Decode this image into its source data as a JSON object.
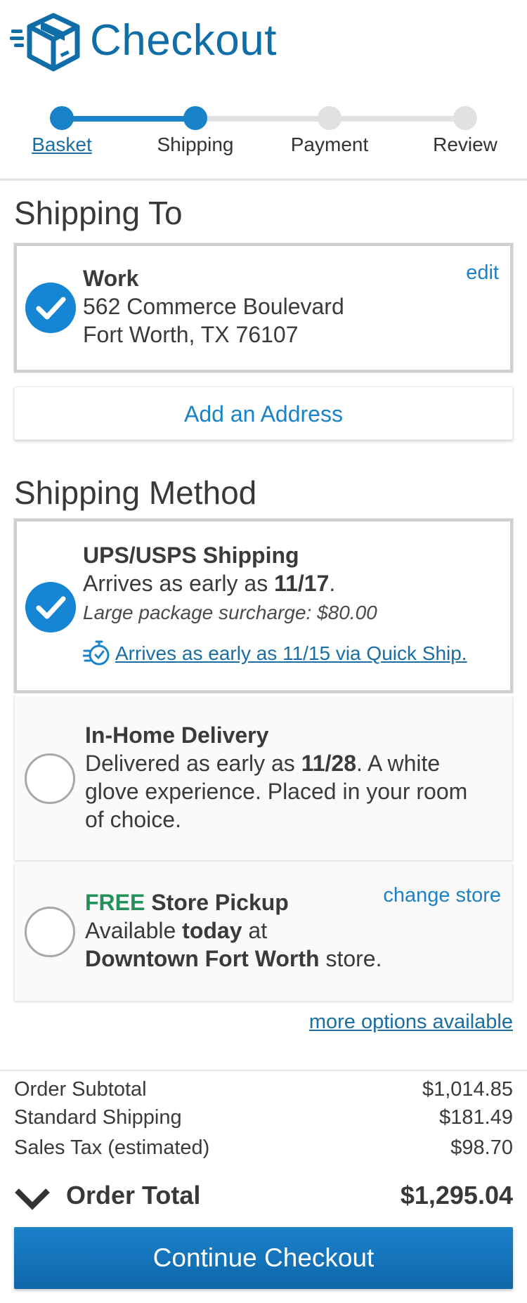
{
  "header": {
    "title": "Checkout",
    "accent": "#0f6da8"
  },
  "steps": [
    {
      "label": "Basket",
      "state": "complete"
    },
    {
      "label": "Shipping",
      "state": "current"
    },
    {
      "label": "Payment",
      "state": "upcoming"
    },
    {
      "label": "Review",
      "state": "upcoming"
    }
  ],
  "shipping_to": {
    "heading": "Shipping To",
    "address": {
      "name": "Work",
      "line1": "562 Commerce Boulevard",
      "line2": "Fort Worth, TX 76107",
      "edit_label": "edit",
      "selected": true
    },
    "add_address_label": "Add an Address"
  },
  "shipping_method": {
    "heading": "Shipping Method",
    "ups": {
      "title": "UPS/USPS Shipping",
      "arrives_prefix": "Arrives as early as ",
      "arrives_date": "11/17",
      "arrives_suffix": ".",
      "surcharge": "Large package surcharge: $80.00",
      "quick_ship": "Arrives as early as 11/15 via Quick Ship.",
      "icon": "quick-ship-stopwatch-icon",
      "selected": true
    },
    "in_home": {
      "title": "In-Home Delivery",
      "l1_prefix": "Delivered as early as ",
      "l1_date": "11/28",
      "l1_suffix": ". A white",
      "l2": "glove experience. Placed in your room",
      "l3": "of choice.",
      "selected": false
    },
    "pickup": {
      "free": "FREE",
      "title": " Store Pickup",
      "l1_prefix": "Available ",
      "l1_bold": "today",
      "l1_suffix": " at",
      "store": "Downtown Fort Worth",
      "store_suffix": " store.",
      "change_label": "change store",
      "selected": false
    },
    "more_options": "more options available"
  },
  "summary": {
    "subtotal_label": "Order Subtotal",
    "subtotal": "$1,014.85",
    "shipping_label": "Standard Shipping",
    "shipping": "$181.49",
    "tax_label": "Sales Tax (estimated)",
    "tax": "$98.70",
    "total_label": "Order Total",
    "total": "$1,295.04"
  },
  "continue_label": "Continue Checkout",
  "colors": {
    "primary": "#1a82c8",
    "check": "#1585d4",
    "free": "#23925a"
  }
}
